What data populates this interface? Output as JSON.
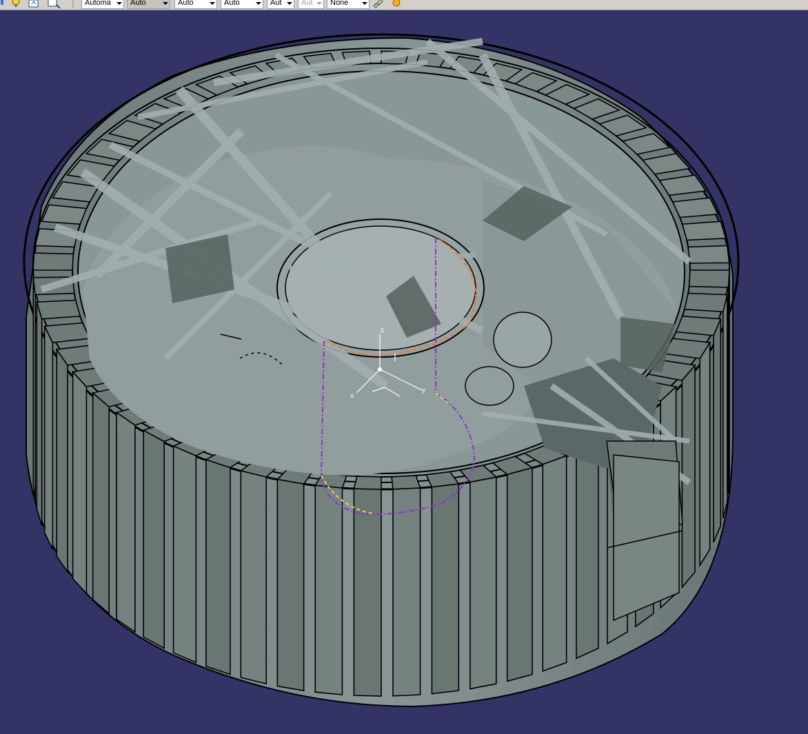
{
  "toolbar": {
    "combos": [
      {
        "value": "Automa"
      },
      {
        "value": "Auto"
      },
      {
        "value": "Auto"
      },
      {
        "value": "Auto"
      },
      {
        "value": "Aut"
      },
      {
        "value": "Aut"
      },
      {
        "value": "None"
      }
    ]
  },
  "viewport": {
    "axis": {
      "x": "x",
      "y": "y",
      "z": "z"
    }
  },
  "colors": {
    "background": "#333366",
    "part": "#8e9a9a",
    "edge": "#000000",
    "sketch_purple": "#8833cc",
    "sketch_orange": "#ee7722",
    "sketch_yellow": "#dddd44"
  }
}
